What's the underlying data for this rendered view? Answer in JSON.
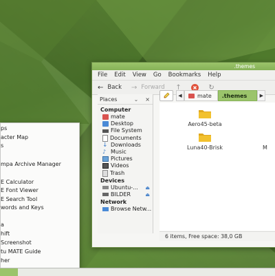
{
  "window": {
    "title": ".themes",
    "menubar": [
      "File",
      "Edit",
      "View",
      "Go",
      "Bookmarks",
      "Help"
    ],
    "toolbar": {
      "back": "Back",
      "forward": "Forward"
    },
    "sidepane": {
      "header": "Places",
      "sections": {
        "computer": "Computer",
        "devices": "Devices",
        "network": "Network"
      },
      "computer_items": [
        "mate",
        "Desktop",
        "File System",
        "Documents",
        "Downloads",
        "Music",
        "Pictures",
        "Videos",
        "Trash"
      ],
      "device_items": [
        "Ubuntu-...",
        "BILDER"
      ],
      "network_items": [
        "Browse Netw..."
      ]
    },
    "pathbar": {
      "home": "mate",
      "current": ".themes"
    },
    "files": [
      "Aero45-beta",
      "Luna40-Brisk",
      "M"
    ],
    "status": "6 items, Free space: 38,0 GB"
  },
  "main_menu": {
    "items": [
      "ps",
      "acter Map",
      "s",
      "",
      "mpa Archive Manager",
      "",
      "E Calculator",
      "E Font Viewer",
      "E Search Tool",
      "words and Keys",
      "",
      "a",
      "hift",
      "Screenshot",
      "tu MATE Guide",
      "her"
    ]
  },
  "colors": {
    "accent": "#9bc46b",
    "folder": "#f2c12e"
  }
}
